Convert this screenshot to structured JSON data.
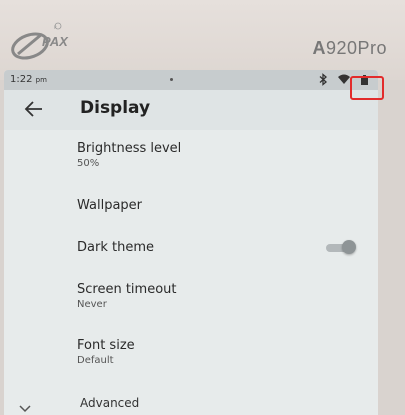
{
  "device": {
    "brand": "PAX",
    "model_prefix": "A",
    "model_rest": "920Pro"
  },
  "status_bar": {
    "time": "1:22",
    "meridiem": "pm",
    "icons": [
      "bluetooth-icon",
      "wifi-icon",
      "battery-icon"
    ]
  },
  "app_bar": {
    "title": "Display",
    "back_icon": "arrow-left-icon"
  },
  "settings": [
    {
      "title": "Brightness level",
      "subtitle": "50%"
    },
    {
      "title": "Wallpaper",
      "subtitle": ""
    },
    {
      "title": "Dark theme",
      "subtitle": "",
      "toggle": false
    },
    {
      "title": "Screen timeout",
      "subtitle": "Never"
    },
    {
      "title": "Font size",
      "subtitle": "Default"
    }
  ],
  "advanced": {
    "label": "Advanced",
    "icon": "chevron-down-icon"
  },
  "colors": {
    "highlight": "#e22b2b",
    "screen_bg": "#e7ebeb",
    "status_bar_bg": "#c7ccce"
  }
}
